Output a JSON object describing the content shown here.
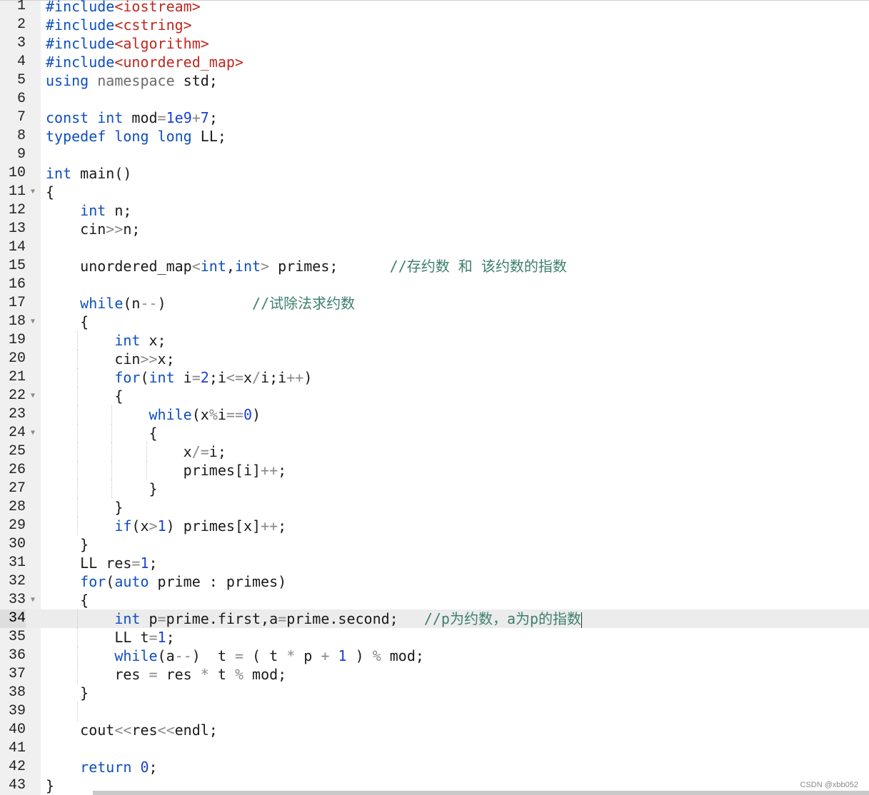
{
  "editor": {
    "active_line": "34",
    "watermark": "CSDN @xbb052",
    "lines": [
      {
        "n": "1",
        "tokens": [
          [
            "hdr-kw",
            "#include"
          ],
          [
            "hdr",
            "<iostream>"
          ]
        ]
      },
      {
        "n": "2",
        "tokens": [
          [
            "hdr-kw",
            "#include"
          ],
          [
            "hdr",
            "<cstring>"
          ]
        ]
      },
      {
        "n": "3",
        "tokens": [
          [
            "hdr-kw",
            "#include"
          ],
          [
            "hdr",
            "<algorithm>"
          ]
        ]
      },
      {
        "n": "4",
        "tokens": [
          [
            "hdr-kw",
            "#include"
          ],
          [
            "hdr",
            "<unordered_map>"
          ]
        ]
      },
      {
        "n": "5",
        "tokens": [
          [
            "kw",
            "using"
          ],
          [
            "t",
            " "
          ],
          [
            "ns",
            "namespace"
          ],
          [
            "t",
            " std;"
          ]
        ]
      },
      {
        "n": "6",
        "tokens": []
      },
      {
        "n": "7",
        "tokens": [
          [
            "kw",
            "const"
          ],
          [
            "t",
            " "
          ],
          [
            "kw",
            "int"
          ],
          [
            "t",
            " mod"
          ],
          [
            "op",
            "="
          ],
          [
            "num",
            "1e9"
          ],
          [
            "op",
            "+"
          ],
          [
            "num",
            "7"
          ],
          [
            "t",
            ";"
          ]
        ]
      },
      {
        "n": "8",
        "tokens": [
          [
            "kw",
            "typedef"
          ],
          [
            "t",
            " "
          ],
          [
            "kw",
            "long"
          ],
          [
            "t",
            " "
          ],
          [
            "kw",
            "long"
          ],
          [
            "t",
            " LL;"
          ]
        ]
      },
      {
        "n": "9",
        "tokens": []
      },
      {
        "n": "10",
        "tokens": [
          [
            "kw",
            "int"
          ],
          [
            "t",
            " main()"
          ]
        ]
      },
      {
        "n": "11",
        "fold": true,
        "tokens": [
          [
            "t",
            "{"
          ]
        ]
      },
      {
        "n": "12",
        "tokens": [
          [
            "t",
            "    "
          ],
          [
            "kw",
            "int"
          ],
          [
            "t",
            " n;"
          ]
        ]
      },
      {
        "n": "13",
        "tokens": [
          [
            "t",
            "    cin"
          ],
          [
            "op",
            ">>"
          ],
          [
            "t",
            "n;"
          ]
        ]
      },
      {
        "n": "14",
        "tokens": []
      },
      {
        "n": "15",
        "tokens": [
          [
            "t",
            "    unordered_map"
          ],
          [
            "op",
            "<"
          ],
          [
            "kw",
            "int"
          ],
          [
            "t",
            ","
          ],
          [
            "kw",
            "int"
          ],
          [
            "op",
            ">"
          ],
          [
            "t",
            " primes;      "
          ],
          [
            "cm",
            "//存约数 和 该约数的指数"
          ]
        ]
      },
      {
        "n": "16",
        "tokens": []
      },
      {
        "n": "17",
        "tokens": [
          [
            "t",
            "    "
          ],
          [
            "kw",
            "while"
          ],
          [
            "t",
            "(n"
          ],
          [
            "op",
            "--"
          ],
          [
            "t",
            ")          "
          ],
          [
            "cm",
            "//试除法求约数"
          ]
        ]
      },
      {
        "n": "18",
        "fold": true,
        "tokens": [
          [
            "t",
            "    {"
          ]
        ]
      },
      {
        "n": "19",
        "guides": [
          1
        ],
        "tokens": [
          [
            "t",
            "        "
          ],
          [
            "kw",
            "int"
          ],
          [
            "t",
            " x;"
          ]
        ]
      },
      {
        "n": "20",
        "guides": [
          1
        ],
        "tokens": [
          [
            "t",
            "        cin"
          ],
          [
            "op",
            ">>"
          ],
          [
            "t",
            "x;"
          ]
        ]
      },
      {
        "n": "21",
        "guides": [
          1
        ],
        "tokens": [
          [
            "t",
            "        "
          ],
          [
            "kw",
            "for"
          ],
          [
            "t",
            "("
          ],
          [
            "kw",
            "int"
          ],
          [
            "t",
            " i"
          ],
          [
            "op",
            "="
          ],
          [
            "num",
            "2"
          ],
          [
            "t",
            ";i"
          ],
          [
            "op",
            "<="
          ],
          [
            "t",
            "x"
          ],
          [
            "op",
            "/"
          ],
          [
            "t",
            "i;i"
          ],
          [
            "op",
            "++"
          ],
          [
            "t",
            ")"
          ]
        ]
      },
      {
        "n": "22",
        "fold": true,
        "guides": [
          1
        ],
        "tokens": [
          [
            "t",
            "        {"
          ]
        ]
      },
      {
        "n": "23",
        "guides": [
          1,
          2
        ],
        "tokens": [
          [
            "t",
            "            "
          ],
          [
            "kw",
            "while"
          ],
          [
            "t",
            "(x"
          ],
          [
            "op",
            "%"
          ],
          [
            "t",
            "i"
          ],
          [
            "op",
            "=="
          ],
          [
            "num",
            "0"
          ],
          [
            "t",
            ")"
          ]
        ]
      },
      {
        "n": "24",
        "fold": true,
        "guides": [
          1,
          2
        ],
        "tokens": [
          [
            "t",
            "            {"
          ]
        ]
      },
      {
        "n": "25",
        "guides": [
          1,
          2,
          3
        ],
        "tokens": [
          [
            "t",
            "                x"
          ],
          [
            "op",
            "/="
          ],
          [
            "t",
            "i;"
          ]
        ]
      },
      {
        "n": "26",
        "guides": [
          1,
          2,
          3
        ],
        "tokens": [
          [
            "t",
            "                primes[i]"
          ],
          [
            "op",
            "++"
          ],
          [
            "t",
            ";"
          ]
        ]
      },
      {
        "n": "27",
        "guides": [
          1,
          2
        ],
        "tokens": [
          [
            "t",
            "            }"
          ]
        ]
      },
      {
        "n": "28",
        "guides": [
          1
        ],
        "tokens": [
          [
            "t",
            "        }"
          ]
        ]
      },
      {
        "n": "29",
        "guides": [
          1
        ],
        "tokens": [
          [
            "t",
            "        "
          ],
          [
            "kw",
            "if"
          ],
          [
            "t",
            "(x"
          ],
          [
            "op",
            ">"
          ],
          [
            "num",
            "1"
          ],
          [
            "t",
            ") primes[x]"
          ],
          [
            "op",
            "++"
          ],
          [
            "t",
            ";"
          ]
        ]
      },
      {
        "n": "30",
        "tokens": [
          [
            "t",
            "    }"
          ]
        ]
      },
      {
        "n": "31",
        "tokens": [
          [
            "t",
            "    LL res"
          ],
          [
            "op",
            "="
          ],
          [
            "num",
            "1"
          ],
          [
            "t",
            ";"
          ]
        ]
      },
      {
        "n": "32",
        "tokens": [
          [
            "t",
            "    "
          ],
          [
            "kw",
            "for"
          ],
          [
            "t",
            "("
          ],
          [
            "kw",
            "auto"
          ],
          [
            "t",
            " prime : primes)"
          ]
        ]
      },
      {
        "n": "33",
        "fold": true,
        "tokens": [
          [
            "t",
            "    {"
          ]
        ]
      },
      {
        "n": "34",
        "guides": [
          1
        ],
        "caret": true,
        "tokens": [
          [
            "t",
            "        "
          ],
          [
            "kw",
            "int"
          ],
          [
            "t",
            " p"
          ],
          [
            "op",
            "="
          ],
          [
            "t",
            "prime.first,a"
          ],
          [
            "op",
            "="
          ],
          [
            "t",
            "prime.second;   "
          ],
          [
            "cm",
            "//p为约数，a为p的指数"
          ]
        ]
      },
      {
        "n": "35",
        "guides": [
          1
        ],
        "tokens": [
          [
            "t",
            "        LL t"
          ],
          [
            "op",
            "="
          ],
          [
            "num",
            "1"
          ],
          [
            "t",
            ";"
          ]
        ]
      },
      {
        "n": "36",
        "guides": [
          1
        ],
        "tokens": [
          [
            "t",
            "        "
          ],
          [
            "kw",
            "while"
          ],
          [
            "t",
            "(a"
          ],
          [
            "op",
            "--"
          ],
          [
            "t",
            ")  t "
          ],
          [
            "op",
            "="
          ],
          [
            "t",
            " ( t "
          ],
          [
            "op",
            "*"
          ],
          [
            "t",
            " p "
          ],
          [
            "op",
            "+"
          ],
          [
            "t",
            " "
          ],
          [
            "num",
            "1"
          ],
          [
            "t",
            " ) "
          ],
          [
            "op",
            "%"
          ],
          [
            "t",
            " mod;"
          ]
        ]
      },
      {
        "n": "37",
        "guides": [
          1
        ],
        "tokens": [
          [
            "t",
            "        res "
          ],
          [
            "op",
            "="
          ],
          [
            "t",
            " res "
          ],
          [
            "op",
            "*"
          ],
          [
            "t",
            " t "
          ],
          [
            "op",
            "%"
          ],
          [
            "t",
            " mod;"
          ]
        ]
      },
      {
        "n": "38",
        "tokens": [
          [
            "t",
            "    }"
          ]
        ]
      },
      {
        "n": "39",
        "guides": [
          1
        ],
        "tokens": []
      },
      {
        "n": "40",
        "tokens": [
          [
            "t",
            "    cout"
          ],
          [
            "op",
            "<<"
          ],
          [
            "t",
            "res"
          ],
          [
            "op",
            "<<"
          ],
          [
            "t",
            "endl;"
          ]
        ]
      },
      {
        "n": "41",
        "tokens": []
      },
      {
        "n": "42",
        "tokens": [
          [
            "t",
            "    "
          ],
          [
            "kw",
            "return"
          ],
          [
            "t",
            " "
          ],
          [
            "num",
            "0"
          ],
          [
            "t",
            ";"
          ]
        ]
      },
      {
        "n": "43",
        "tokens": [
          [
            "t",
            "}"
          ]
        ]
      }
    ]
  }
}
